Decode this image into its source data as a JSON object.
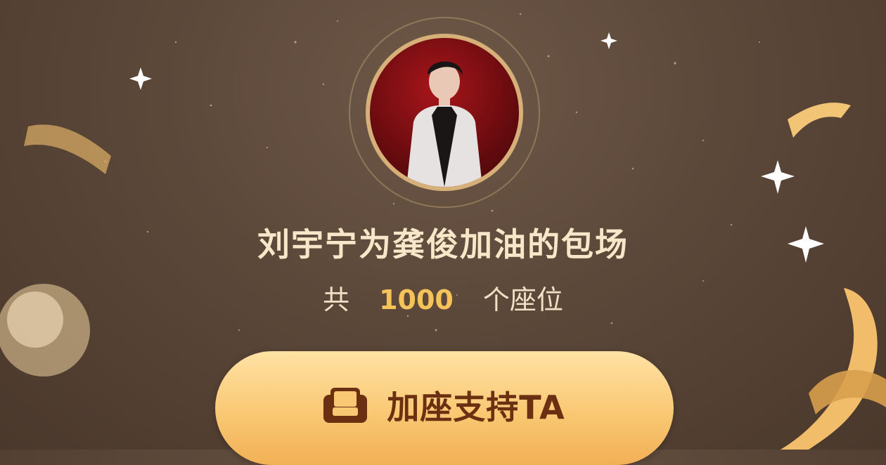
{
  "banner": {
    "title": "刘宇宁为龚俊加油的包场",
    "seat_prefix": "共",
    "seat_count": "1000",
    "seat_suffix": "个座位"
  },
  "cta": {
    "label": "加座支持TA",
    "icon": "seat-icon"
  },
  "colors": {
    "background": "#5c4839",
    "title": "#f8e7c8",
    "accent_number": "#f6c35b",
    "button_fill": "#f9c873",
    "button_text": "#6b2f12"
  }
}
